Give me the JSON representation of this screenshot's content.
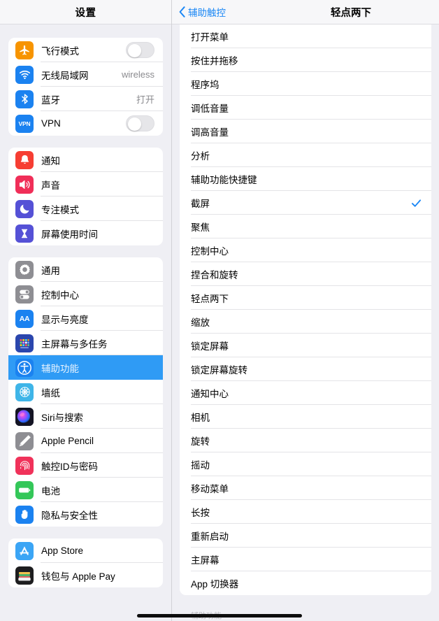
{
  "sidebar": {
    "title": "设置",
    "groups": [
      {
        "items": [
          {
            "label": "飞行模式",
            "icon": "airplane-icon",
            "icon_color": "#f79400",
            "control": "toggle",
            "toggle_on": false
          },
          {
            "label": "无线局域网",
            "icon": "wifi-icon",
            "icon_color": "#1b82f0",
            "control": "value",
            "value": "wireless"
          },
          {
            "label": "蓝牙",
            "icon": "bluetooth-icon",
            "icon_color": "#1b82f0",
            "control": "value",
            "value": "打开"
          },
          {
            "label": "VPN",
            "icon": "vpn-icon",
            "icon_color": "#1b82f0",
            "control": "toggle",
            "toggle_on": false
          }
        ]
      },
      {
        "items": [
          {
            "label": "通知",
            "icon": "bell-icon",
            "icon_color": "#f63e33",
            "control": "none"
          },
          {
            "label": "声音",
            "icon": "speaker-icon",
            "icon_color": "#f02e58",
            "control": "none"
          },
          {
            "label": "专注模式",
            "icon": "moon-icon",
            "icon_color": "#5551d6",
            "control": "none"
          },
          {
            "label": "屏幕使用时间",
            "icon": "hourglass-icon",
            "icon_color": "#5551d6",
            "control": "none"
          }
        ]
      },
      {
        "items": [
          {
            "label": "通用",
            "icon": "gear-icon",
            "icon_color": "#8e8e93",
            "control": "none"
          },
          {
            "label": "控制中心",
            "icon": "control-center-icon",
            "icon_color": "#8e8e93",
            "control": "none"
          },
          {
            "label": "显示与亮度",
            "icon": "display-aa-icon",
            "icon_color": "#1b82f0",
            "control": "none"
          },
          {
            "label": "主屏幕与多任务",
            "icon": "home-screen-icon",
            "icon_color": "#2b46ad",
            "control": "none"
          },
          {
            "label": "辅助功能",
            "icon": "accessibility-icon",
            "icon_color": "#1b82f0",
            "control": "none",
            "selected": true
          },
          {
            "label": "墙纸",
            "icon": "wallpaper-icon",
            "icon_color": "#3fb5e8",
            "control": "none"
          },
          {
            "label": "Siri与搜索",
            "icon": "siri-icon",
            "icon_color": "#1d1d2e",
            "control": "none"
          },
          {
            "label": "Apple Pencil",
            "icon": "pencil-icon",
            "icon_color": "#8e8e93",
            "control": "none"
          },
          {
            "label": "触控ID与密码",
            "icon": "touch-id-icon",
            "icon_color": "#f0325a",
            "control": "none"
          },
          {
            "label": "电池",
            "icon": "battery-icon",
            "icon_color": "#34c759",
            "control": "none"
          },
          {
            "label": "隐私与安全性",
            "icon": "privacy-hand-icon",
            "icon_color": "#1b82f0",
            "control": "none"
          }
        ]
      },
      {
        "items": [
          {
            "label": "App Store",
            "icon": "app-store-icon",
            "icon_color": "#3ba5f5",
            "control": "none"
          },
          {
            "label": "钱包与 Apple Pay",
            "icon": "wallet-icon",
            "icon_color": "#1d1d1f",
            "control": "none"
          }
        ]
      }
    ]
  },
  "detail": {
    "back_label": "辅助触控",
    "title": "轻点两下",
    "footer_note": "辅助功能",
    "accent_color": "#1b87f5",
    "options": [
      {
        "label": "打开菜单",
        "checked": false
      },
      {
        "label": "按住并拖移",
        "checked": false
      },
      {
        "label": "程序坞",
        "checked": false
      },
      {
        "label": "调低音量",
        "checked": false
      },
      {
        "label": "调高音量",
        "checked": false
      },
      {
        "label": "分析",
        "checked": false
      },
      {
        "label": "辅助功能快捷键",
        "checked": false
      },
      {
        "label": "截屏",
        "checked": true
      },
      {
        "label": "聚焦",
        "checked": false
      },
      {
        "label": "控制中心",
        "checked": false
      },
      {
        "label": "捏合和旋转",
        "checked": false
      },
      {
        "label": "轻点两下",
        "checked": false
      },
      {
        "label": "缩放",
        "checked": false
      },
      {
        "label": "锁定屏幕",
        "checked": false
      },
      {
        "label": "锁定屏幕旋转",
        "checked": false
      },
      {
        "label": "通知中心",
        "checked": false
      },
      {
        "label": "相机",
        "checked": false
      },
      {
        "label": "旋转",
        "checked": false
      },
      {
        "label": "摇动",
        "checked": false
      },
      {
        "label": "移动菜单",
        "checked": false
      },
      {
        "label": "长按",
        "checked": false
      },
      {
        "label": "重新启动",
        "checked": false
      },
      {
        "label": "主屏幕",
        "checked": false
      },
      {
        "label": "App 切换器",
        "checked": false
      }
    ]
  }
}
